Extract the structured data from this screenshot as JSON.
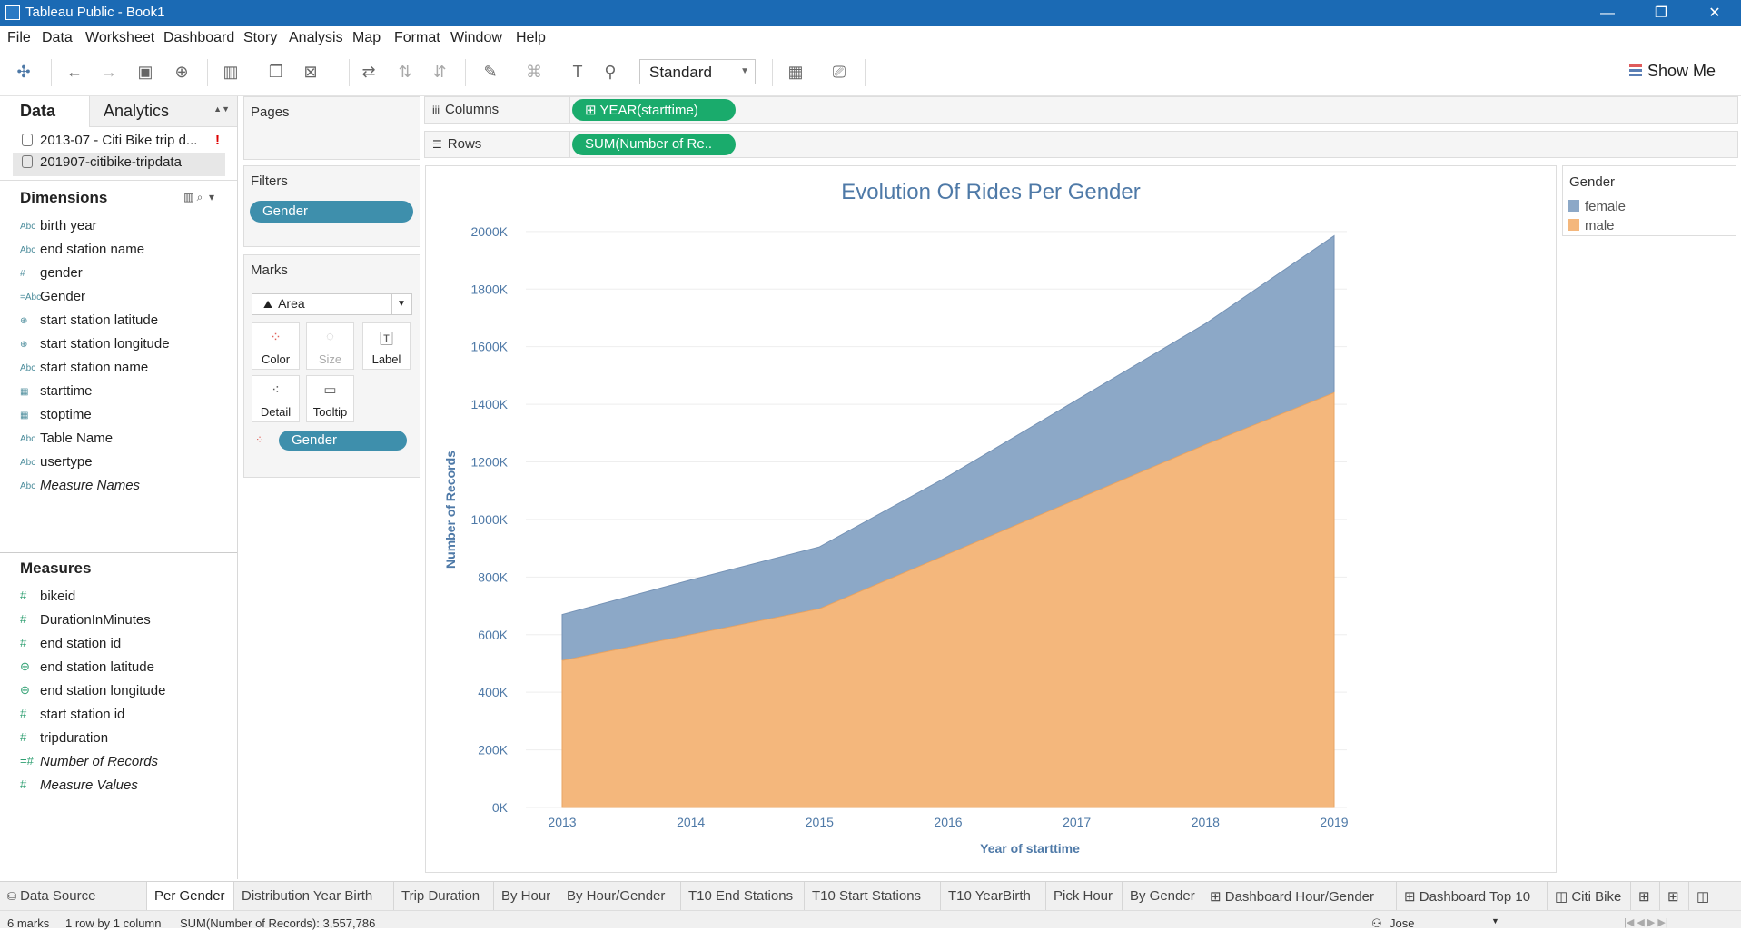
{
  "window": {
    "title": "Tableau Public - Book1",
    "minimize": "—",
    "restore": "❐",
    "close": "✕"
  },
  "menu": [
    "File",
    "Data",
    "Worksheet",
    "Dashboard",
    "Story",
    "Analysis",
    "Map",
    "Format",
    "Window",
    "Help"
  ],
  "toolbar": {
    "fit_mode": "Standard",
    "show_me": "Show Me"
  },
  "data_pane": {
    "tabs": {
      "data": "Data",
      "analytics": "Analytics"
    },
    "sources": [
      {
        "name": "2013-07 - Citi Bike trip d...",
        "warning": "!"
      },
      {
        "name": "201907-citibike-tripdata"
      }
    ],
    "dimensions_header": "Dimensions",
    "dimensions": [
      {
        "type": "Abc",
        "name": "birth year"
      },
      {
        "type": "Abc",
        "name": "end station name"
      },
      {
        "type": "#",
        "name": "gender"
      },
      {
        "type": "=Abc",
        "name": "Gender"
      },
      {
        "type": "⊕",
        "name": "start station latitude"
      },
      {
        "type": "⊕",
        "name": "start station longitude"
      },
      {
        "type": "Abc",
        "name": "start station name"
      },
      {
        "type": "▦",
        "name": "starttime"
      },
      {
        "type": "▦",
        "name": "stoptime"
      },
      {
        "type": "Abc",
        "name": "Table Name"
      },
      {
        "type": "Abc",
        "name": "usertype"
      },
      {
        "type": "Abc",
        "name": "Measure Names"
      }
    ],
    "measures_header": "Measures",
    "measures": [
      {
        "type": "#",
        "name": "bikeid"
      },
      {
        "type": "#",
        "name": "DurationInMinutes"
      },
      {
        "type": "#",
        "name": "end station id"
      },
      {
        "type": "⊕",
        "name": "end station latitude"
      },
      {
        "type": "⊕",
        "name": "end station longitude"
      },
      {
        "type": "#",
        "name": "start station id"
      },
      {
        "type": "#",
        "name": "tripduration"
      },
      {
        "type": "=#",
        "name": "Number of Records"
      },
      {
        "type": "#",
        "name": "Measure Values"
      }
    ]
  },
  "cards": {
    "pages": "Pages",
    "filters": "Filters",
    "filter_pill": "Gender",
    "marks": "Marks",
    "mark_type": "Area",
    "mark_buttons": {
      "color": "Color",
      "size": "Size",
      "label": "Label",
      "detail": "Detail",
      "tooltip": "Tooltip"
    },
    "marks_pill": "Gender"
  },
  "shelves": {
    "columns_label": "Columns",
    "columns_pill": "⊞ YEAR(starttime)",
    "rows_label": "Rows",
    "rows_pill": "SUM(Number of Re.."
  },
  "legend": {
    "title": "Gender",
    "items": [
      {
        "label": "female",
        "color": "#8ca8c7"
      },
      {
        "label": "male",
        "color": "#f4b77c"
      }
    ]
  },
  "chart_data": {
    "type": "area",
    "stacked": true,
    "title": "Evolution Of Rides Per Gender",
    "xlabel": "Year of starttime",
    "ylabel": "Number of Records",
    "x": [
      "2013",
      "2014",
      "2015",
      "2016",
      "2017",
      "2018",
      "2019"
    ],
    "yticks": [
      "0K",
      "200K",
      "400K",
      "600K",
      "800K",
      "1000K",
      "1200K",
      "1400K",
      "1600K",
      "1800K",
      "2000K"
    ],
    "ylim": [
      0,
      2050000
    ],
    "series": [
      {
        "name": "male",
        "color": "#f4b77c",
        "values": [
          510000,
          600000,
          690000,
          880000,
          1070000,
          1260000,
          1440000
        ]
      },
      {
        "name": "female",
        "color": "#8ca8c7",
        "values": [
          160000,
          190000,
          215000,
          270000,
          345000,
          420000,
          545000
        ]
      }
    ],
    "legend": "right",
    "grid": true
  },
  "sheet_tabs": [
    "Data Source",
    "Per Gender",
    "Distribution Year Birth",
    "Trip Duration",
    "By Hour",
    "By Hour/Gender",
    "T10 End Stations",
    "T10 Start Stations",
    "T10 YearBirth",
    "Pick Hour",
    "By Gender",
    "⊞ Dashboard Hour/Gender",
    "⊞ Dashboard Top 10",
    "◫ Citi Bike"
  ],
  "status": {
    "marks": "6 marks",
    "rows": "1 row by 1 column",
    "sum": "SUM(Number of Records): 3,557,786",
    "user": "Jose"
  }
}
